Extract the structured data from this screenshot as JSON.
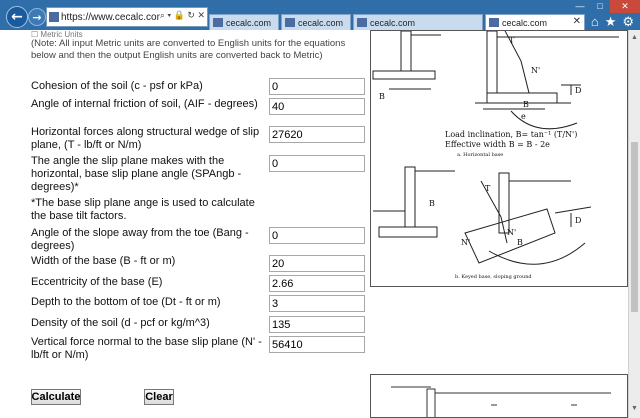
{
  "browser": {
    "url": "https://www.cecalc.com/Retain",
    "tabs": [
      {
        "label": "cecalc.com"
      },
      {
        "label": "cecalc.com"
      },
      {
        "label": "cecalc.com"
      },
      {
        "label": "cecalc.com"
      }
    ],
    "window_controls": [
      "—",
      "□",
      "✕"
    ]
  },
  "form": {
    "metric_checkbox_label": "Metric Units",
    "note": "(Note: All input Metric units are converted to English units for the equations below and then the output English units are converted back to Metric)",
    "fields": [
      {
        "label": "Cohesion of the soil (c - psf or kPa)",
        "value": "0"
      },
      {
        "label": "Angle of internal friction of soil, (AIF - degrees)",
        "value": "40"
      },
      {
        "label": "Horizontal forces along structural wedge of slip plane, (T - lb/ft or N/m)",
        "value": "27620"
      },
      {
        "label": "The angle the slip plane makes with the horizontal, base slip plane angle (SPAngb - degrees)*",
        "value": "0"
      },
      {
        "label": "Angle of the slope away from the toe (Bang - degrees)",
        "value": "0"
      },
      {
        "label": "Width of the base (B - ft or m)",
        "value": "20"
      },
      {
        "label": "Eccentricity of the base (E)",
        "value": "2.66"
      },
      {
        "label": "Depth to the bottom of toe (Dt - ft or m)",
        "value": "3"
      },
      {
        "label": "Density of the soil (d - pcf or kg/m^3)",
        "value": "135"
      },
      {
        "label": "Vertical force normal to the base slip plane (N' - lb/ft or N/m)",
        "value": "56410"
      }
    ],
    "base_note": "*The base slip plane ange is used to calculate the base tilt factors.",
    "calculate_label": "Calculate",
    "clear_label": "Clear"
  },
  "figure": {
    "load_inclination": "Load inclination, B= tan⁻¹ (T/N')",
    "effective_width": "Effective width B = B - 2e",
    "caption_a": "a. Horizontal base",
    "caption_b": "b. Keyed base, sloping ground",
    "labels": {
      "B": "B",
      "T": "T",
      "N": "N'",
      "D": "D",
      "e": "e"
    }
  }
}
